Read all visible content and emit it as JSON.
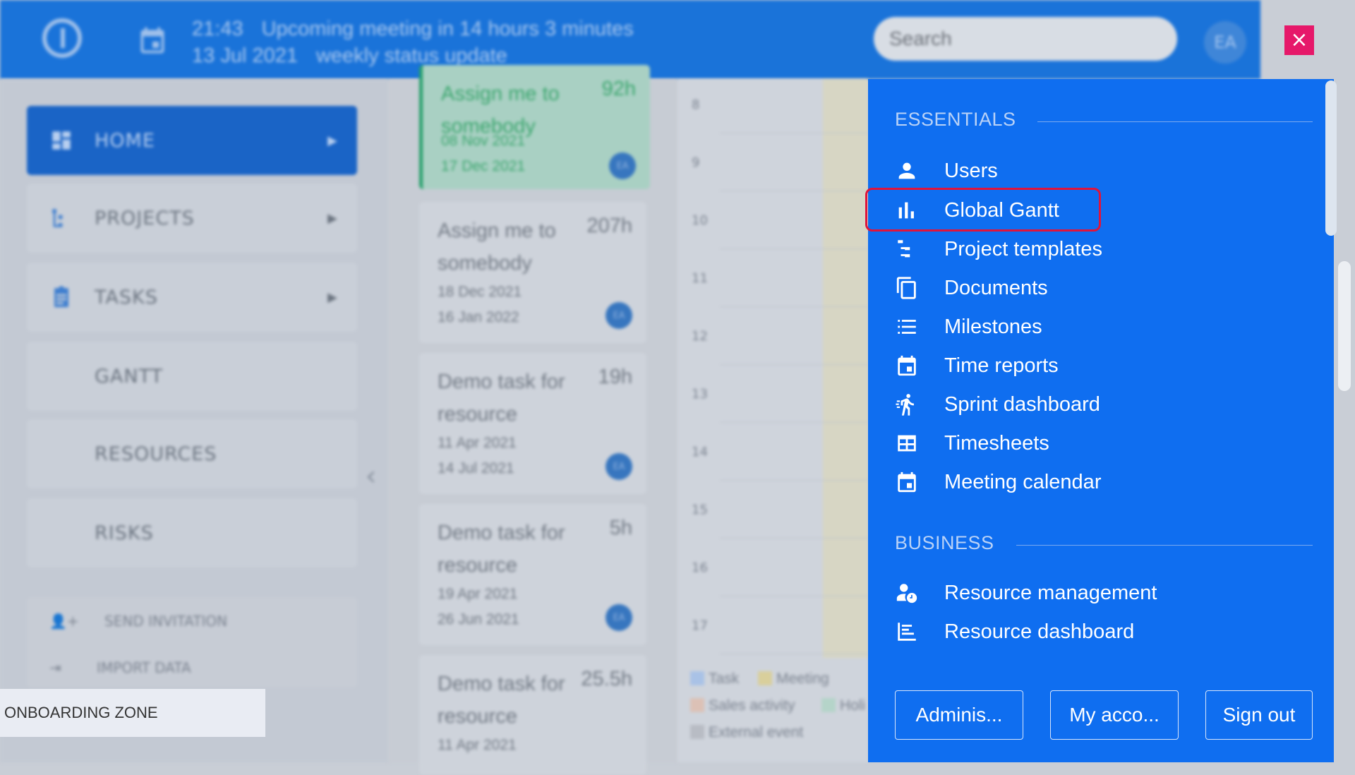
{
  "topbar": {
    "meeting_time": "21:43",
    "meeting_text": "Upcoming meeting in 14 hours 3 minutes",
    "meeting_date": "13 Jul 2021",
    "meeting_title": "weekly status update",
    "search_placeholder": "Search",
    "avatar": "EA",
    "close": "×"
  },
  "sidebar": {
    "items": [
      {
        "label": "HOME"
      },
      {
        "label": "PROJECTS"
      },
      {
        "label": "TASKS"
      },
      {
        "label": "GANTT"
      },
      {
        "label": "RESOURCES"
      },
      {
        "label": "RISKS"
      }
    ],
    "send_invitation": "SEND INVITATION",
    "import_data": "IMPORT DATA",
    "onboarding": "ONBOARDING ZONE"
  },
  "cards": [
    {
      "title": "Assign me to somebody",
      "hours": "92h",
      "start": "08 Nov 2021",
      "end": "17 Dec 2021",
      "avatar": "EA"
    },
    {
      "title": "Assign me to somebody",
      "hours": "207h",
      "start": "18 Dec 2021",
      "end": "16 Jan 2022",
      "avatar": "EA"
    },
    {
      "title": "Demo task for resource",
      "hours": "19h",
      "start": "11 Apr 2021",
      "end": "14 Jul 2021",
      "avatar": "EA"
    },
    {
      "title": "Demo task for resource",
      "hours": "5h",
      "start": "19 Apr 2021",
      "end": "26 Jun 2021",
      "avatar": "EA"
    },
    {
      "title": "Demo task for resource",
      "hours": "25.5h",
      "start": "11 Apr 2021",
      "end": "",
      "avatar": ""
    }
  ],
  "calendar": {
    "hours": [
      "8",
      "9",
      "10",
      "11",
      "12",
      "13",
      "14",
      "15",
      "16",
      "17"
    ],
    "legend": [
      {
        "label": "Task",
        "color": "#a9c2e6"
      },
      {
        "label": "Meeting",
        "color": "#d9cf9c"
      },
      {
        "label": "Sales activity",
        "color": "#dcc1b6"
      },
      {
        "label": "Holi",
        "color": "#b5d4c9"
      },
      {
        "label": "External event",
        "color": "#b8bcc4"
      }
    ]
  },
  "panel": {
    "essentials_heading": "ESSENTIALS",
    "essentials": [
      {
        "label": "Users",
        "icon": "user-icon"
      },
      {
        "label": "Global Gantt",
        "icon": "bar-chart-icon"
      },
      {
        "label": "Project templates",
        "icon": "tree-icon"
      },
      {
        "label": "Documents",
        "icon": "copy-icon"
      },
      {
        "label": "Milestones",
        "icon": "list-icon"
      },
      {
        "label": "Time reports",
        "icon": "calendar-icon"
      },
      {
        "label": "Sprint dashboard",
        "icon": "running-icon"
      },
      {
        "label": "Timesheets",
        "icon": "grid-icon"
      },
      {
        "label": "Meeting calendar",
        "icon": "calendar-icon"
      }
    ],
    "business_heading": "BUSINESS",
    "business": [
      {
        "label": "Resource management",
        "icon": "user-clock-icon"
      },
      {
        "label": "Resource dashboard",
        "icon": "dashboard-icon"
      }
    ],
    "buttons": {
      "admin": "Adminis...",
      "account": "My acco...",
      "signout": "Sign out"
    }
  },
  "colors": {
    "panel": "#0f6ef0",
    "topbar": "#1a73d9",
    "highlight": "#e0143b",
    "close": "#e6186a"
  }
}
